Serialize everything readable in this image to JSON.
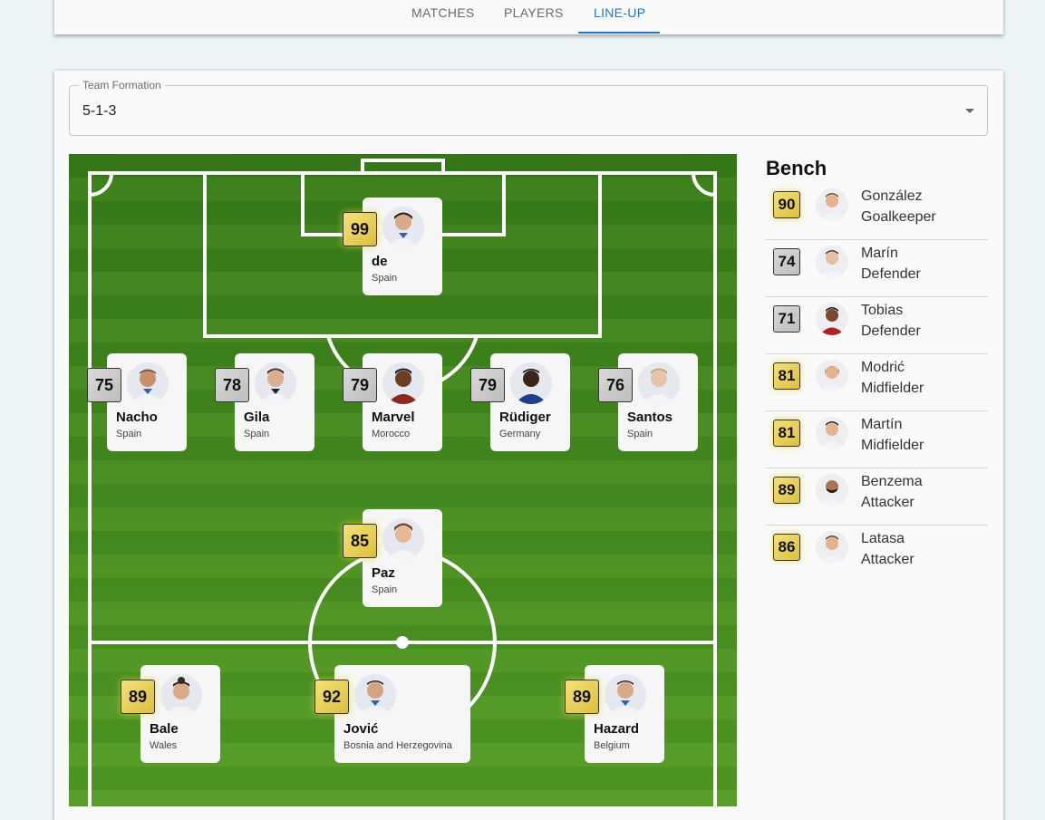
{
  "tabs": [
    {
      "label": "MATCHES"
    },
    {
      "label": "PLAYERS"
    },
    {
      "label": "LINE-UP"
    }
  ],
  "active_tab": "LINE-UP",
  "formation": {
    "label": "Team Formation",
    "value": "5-1-3"
  },
  "lineup": {
    "goalkeeper": {
      "rating": "99",
      "name": "de",
      "country": "Spain",
      "tier": "gold"
    },
    "defenders": [
      {
        "rating": "75",
        "name": "Nacho",
        "country": "Spain",
        "tier": "silver"
      },
      {
        "rating": "78",
        "name": "Gila",
        "country": "Spain",
        "tier": "silver"
      },
      {
        "rating": "79",
        "name": "Marvel",
        "country": "Morocco",
        "tier": "silver"
      },
      {
        "rating": "79",
        "name": "Rüdiger",
        "country": "Germany",
        "tier": "silver"
      },
      {
        "rating": "76",
        "name": "Santos",
        "country": "Spain",
        "tier": "silver"
      }
    ],
    "midfielder": {
      "rating": "85",
      "name": "Paz",
      "country": "Spain",
      "tier": "gold"
    },
    "attackers": [
      {
        "rating": "89",
        "name": "Bale",
        "country": "Wales",
        "tier": "gold"
      },
      {
        "rating": "92",
        "name": "Jović",
        "country": "Bosnia and Herzegovina",
        "tier": "gold"
      },
      {
        "rating": "89",
        "name": "Hazard",
        "country": "Belgium",
        "tier": "gold"
      }
    ]
  },
  "bench": {
    "title": "Bench",
    "players": [
      {
        "rating": "90",
        "name": "González",
        "position": "Goalkeeper",
        "tier": "gold"
      },
      {
        "rating": "74",
        "name": "Marín",
        "position": "Defender",
        "tier": "silver"
      },
      {
        "rating": "71",
        "name": "Tobias",
        "position": "Defender",
        "tier": "silver"
      },
      {
        "rating": "81",
        "name": "Modrić",
        "position": "Midfielder",
        "tier": "gold"
      },
      {
        "rating": "81",
        "name": "Martín",
        "position": "Midfielder",
        "tier": "gold"
      },
      {
        "rating": "89",
        "name": "Benzema",
        "position": "Attacker",
        "tier": "gold"
      },
      {
        "rating": "86",
        "name": "Latasa",
        "position": "Attacker",
        "tier": "gold"
      }
    ]
  },
  "colors": {
    "accent": "#1976d2",
    "gold": "#e8cf55",
    "silver": "#c8c8c8",
    "pitch": "#4c9626"
  }
}
